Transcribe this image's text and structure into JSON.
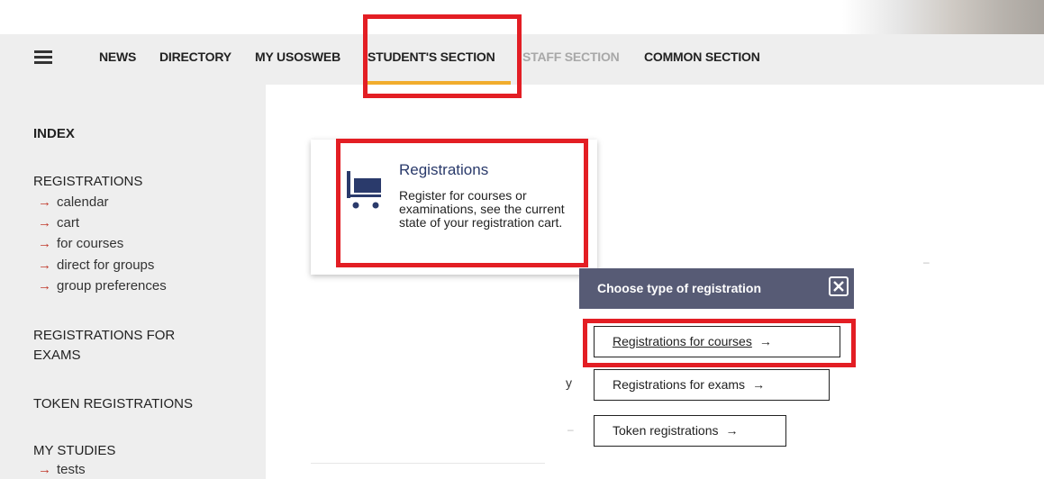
{
  "nav": {
    "items": [
      {
        "label": "NEWS"
      },
      {
        "label": "DIRECTORY"
      },
      {
        "label": "MY USOSWEB"
      },
      {
        "label": "STUDENT'S SECTION"
      },
      {
        "label": "STAFF SECTION"
      },
      {
        "label": "COMMON SECTION"
      }
    ],
    "active_color": "#f1ad2d"
  },
  "sidebar": {
    "index": "INDEX",
    "registrations": {
      "heading": "REGISTRATIONS",
      "links": [
        "calendar",
        "cart",
        "for courses",
        "direct for groups",
        "group preferences"
      ]
    },
    "registrations_exams": "REGISTRATIONS FOR EXAMS",
    "token_registrations": "TOKEN REGISTRATIONS",
    "my_studies": {
      "heading": "MY STUDIES",
      "links": [
        "tests"
      ]
    },
    "arrow": "→"
  },
  "card": {
    "title": "Registrations",
    "description": "Register for courses or examinations, see the current state of your registration cart.",
    "icon": "cart-icon"
  },
  "popup": {
    "title": "Choose type of registration",
    "close_icon": "close-icon",
    "options": [
      {
        "label": "Registrations for courses"
      },
      {
        "label": "Registrations for exams"
      },
      {
        "label": "Token registrations"
      }
    ],
    "arrow": "→"
  },
  "fragments": {
    "y": "y",
    "dash": "–"
  },
  "colors": {
    "highlight": "#e31e24",
    "popup_header": "#575b75",
    "card_title": "#2a3a6b"
  }
}
